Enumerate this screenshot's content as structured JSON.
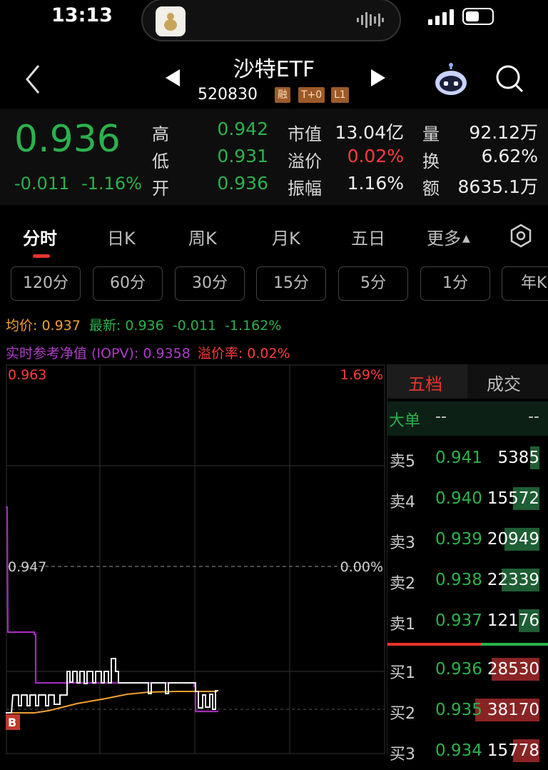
{
  "status_bar": {
    "time": "13:13"
  },
  "header": {
    "title": "沙特ETF",
    "code": "520830",
    "tags": [
      "融",
      "T+0",
      "L1"
    ]
  },
  "quote": {
    "price": "0.936",
    "change": "-0.011",
    "change_pct": "-1.16%",
    "stats": [
      {
        "label": "高",
        "value": "0.942",
        "color": "#2bb24c"
      },
      {
        "label": "低",
        "value": "0.931",
        "color": "#2bb24c"
      },
      {
        "label": "开",
        "value": "0.936",
        "color": "#2bb24c"
      },
      {
        "label": "市值",
        "value": "13.04亿",
        "color": "#eeeeee"
      },
      {
        "label": "溢价",
        "value": "0.02%",
        "color": "#ff3b3b"
      },
      {
        "label": "振幅",
        "value": "1.16%",
        "color": "#eeeeee"
      },
      {
        "label": "量",
        "value": "92.12万",
        "color": "#eeeeee"
      },
      {
        "label": "换",
        "value": "6.62%",
        "color": "#eeeeee"
      },
      {
        "label": "额",
        "value": "8635.1万",
        "color": "#eeeeee"
      }
    ]
  },
  "tabs": [
    "分时",
    "日K",
    "周K",
    "月K",
    "五日",
    "更多"
  ],
  "period_pills": [
    "120分",
    "60分",
    "30分",
    "15分",
    "5分",
    "1分",
    "年K"
  ],
  "legend": {
    "avg_label": "均价: 0.937",
    "latest_label": "最新: 0.936",
    "latest_change": "-0.011",
    "latest_pct": "-1.162%",
    "iopv_label": "实时参考净值 (IOPV): 0.9358",
    "premium_label": "溢价率: 0.02%"
  },
  "chart_labels": {
    "top_price": "0.963",
    "top_pct": "1.69%",
    "mid_price": "0.947",
    "mid_pct": "0.00%",
    "b_marker": "B"
  },
  "chart_data": {
    "type": "line",
    "ylim": [
      0.931,
      0.963
    ],
    "reference_price": 0.947,
    "series": [
      {
        "name": "最新",
        "color": "#e8e8e8"
      },
      {
        "name": "均价",
        "color": "#f0a030"
      },
      {
        "name": "IOPV",
        "color": "#b03cc8"
      }
    ]
  },
  "order_book": {
    "tabs": [
      "五档",
      "成交"
    ],
    "big_order_label": "大单",
    "big_order_values": [
      "--",
      "--"
    ],
    "asks": [
      {
        "label": "卖5",
        "price": "0.941",
        "volume": "5385",
        "fill": 0.14
      },
      {
        "label": "卖4",
        "price": "0.940",
        "volume": "15572",
        "fill": 0.41
      },
      {
        "label": "卖3",
        "price": "0.939",
        "volume": "20949",
        "fill": 0.55
      },
      {
        "label": "卖2",
        "price": "0.938",
        "volume": "22339",
        "fill": 0.59
      },
      {
        "label": "卖1",
        "price": "0.937",
        "volume": "12176",
        "fill": 0.32
      }
    ],
    "bids": [
      {
        "label": "买1",
        "price": "0.936",
        "volume": "28530",
        "fill": 0.75
      },
      {
        "label": "买2",
        "price": "0.935",
        "volume": "38170",
        "fill": 1.0
      },
      {
        "label": "买3",
        "price": "0.934",
        "volume": "15778",
        "fill": 0.41
      }
    ]
  }
}
